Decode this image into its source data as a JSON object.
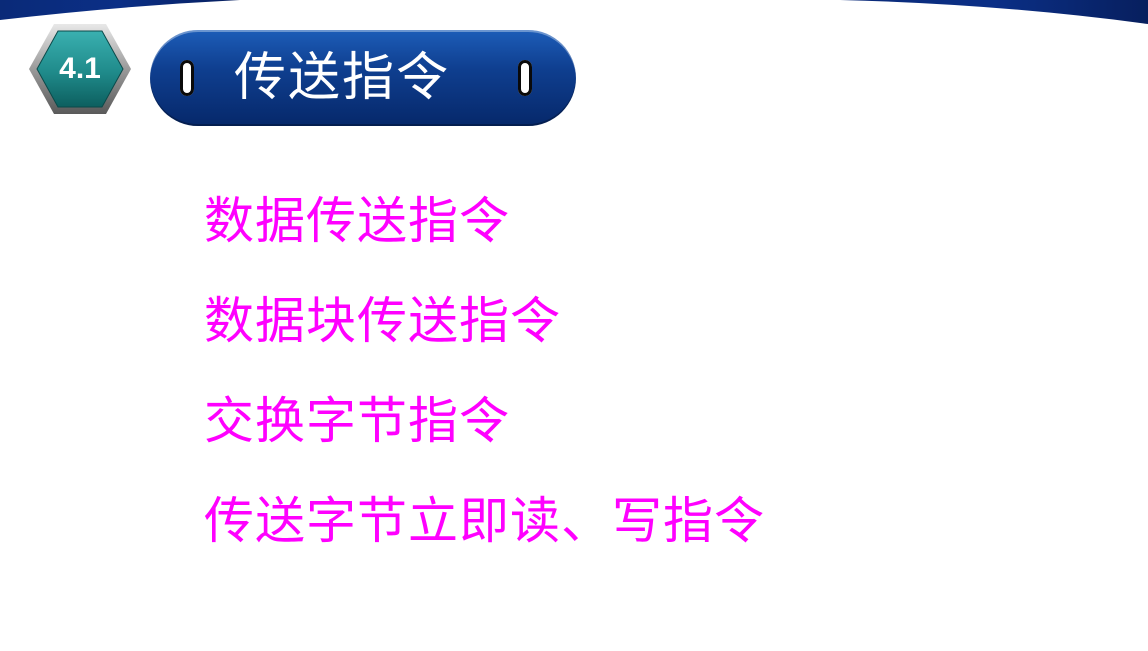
{
  "slide": {
    "section_number": "4.1",
    "title": "传送指令",
    "items": [
      "数据传送指令",
      "数据块传送指令",
      "交换字节指令",
      "传送字节立即读、写指令"
    ]
  },
  "colors": {
    "header_band": "#0b2a7a",
    "title_pill": "#0f3f90",
    "badge": "#1f8a8a",
    "item_text": "#ff00ff"
  }
}
